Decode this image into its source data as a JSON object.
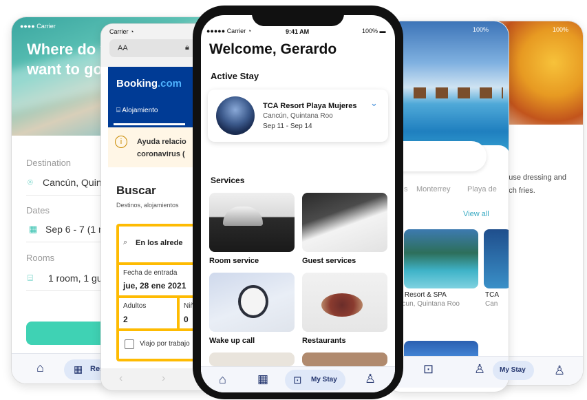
{
  "phone1": {
    "hero_title_line1": "Where do y",
    "hero_title_line2": "want to go",
    "status": "Carrier",
    "destination_label": "Destination",
    "destination_value": "Cancún, Quintan",
    "dates_label": "Dates",
    "dates_value": "Sep 6 - 7  (1 nig",
    "rooms_label": "Rooms",
    "rooms_value": "1 room, 1 gues",
    "search_button": "S",
    "tab_res": "Rese"
  },
  "phone2": {
    "status": "Carrier",
    "url_prefix": "AA",
    "url_text": "b",
    "brand": "Booking",
    "brand_suffix": ".com",
    "nav_item": "Alojamiento",
    "notice_line1": "Ayuda relacio",
    "notice_line2": "coronavirus (",
    "search_title": "Buscar",
    "search_sub": "Destinos, alojamientos",
    "search_placeholder": "En los alrede",
    "checkin_label": "Fecha de entrada",
    "checkin_value": "jue, 28 ene 2021",
    "adults_label": "Adultos",
    "adults_value": "2",
    "kids_label": "Niñ",
    "kids_value": "0",
    "work_trip": "Viajo por trabajo"
  },
  "phone4": {
    "battery": "100%",
    "chip1": "s",
    "chip2": "Monterrey",
    "chip3": "Playa de",
    "view_all": "View all",
    "hotel1_name": "A Resort & SPA",
    "hotel1_loc": "ncun, Quintana Roo",
    "hotel2_name": "TCA",
    "hotel2_loc": "Can",
    "tab_mystay": "My Stay"
  },
  "phone5": {
    "battery": "100%",
    "desc": "house dressing and ench fries."
  },
  "main": {
    "status_carrier": "Carrier",
    "status_time": "9:41 AM",
    "status_battery": "100%",
    "welcome": "Welcome, Gerardo",
    "active_stay_heading": "Active Stay",
    "stay_hotel": "TCA Resort Playa Mujeres",
    "stay_location": "Cancún, Quintana Roo",
    "stay_dates": "Sep 11 - Sep 14",
    "services_heading": "Services",
    "services": [
      {
        "label": "Room service"
      },
      {
        "label": "Guest services"
      },
      {
        "label": "Wake up call"
      },
      {
        "label": "Restaurants"
      }
    ],
    "tab_mystay": "My Stay"
  },
  "colors": {
    "booking_blue": "#003b95",
    "booking_yellow": "#febb02",
    "accent_teal": "#37c2b0",
    "nav_blue": "#23356e",
    "tab_pill": "#dfe8f8"
  }
}
